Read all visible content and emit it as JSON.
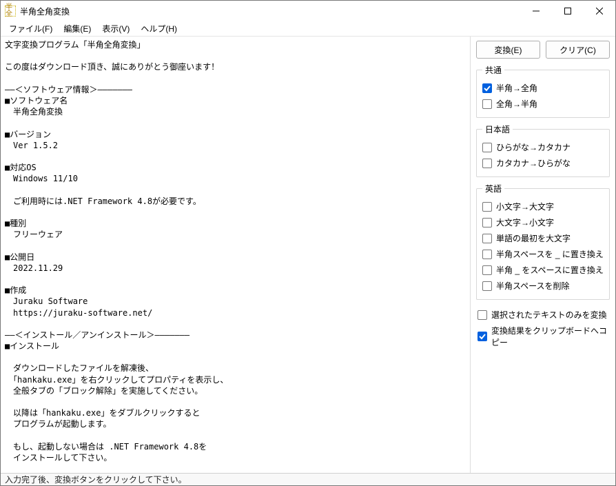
{
  "window": {
    "title": "半角全角変換",
    "icon_label": "半全"
  },
  "menubar": {
    "file": "ファイル(F)",
    "edit": "編集(E)",
    "view": "表示(V)",
    "help": "ヘルプ(H)"
  },
  "editor": "文字変換プログラム「半角全角変換」\n\nこの度はダウンロード頂き、誠にありがとう御座います！\n\n――＜ソフトウェア情報＞―――――――\n■ソフトウェア名\n　半角全角変換\n\n■バージョン\n　Ver 1.5.2\n\n■対応OS\n　Windows 11/10\n\n　ご利用時には.NET Framework 4.8が必要です。\n\n■種別\n　フリーウェア\n\n■公開日\n　2022.11.29\n\n■作成\n　Juraku Software\n　https://juraku-software.net/\n\n――＜インストール／アンインストール＞―――――――\n■インストール\n\n　ダウンロードしたファイルを解凍後、\n　「hankaku.exe」を右クリックしてプロパティを表示し、\n　全般タブの「ブロック解除」を実施してください。\n\n　以降は「hankaku.exe」をダブルクリックすると\n　プログラムが起動します。\n\n　もし、起動しない場合は .NET Framework 4.8を\n　インストールして下さい。\n\n\n■アンインストール\n\n　ダウンロードしたファイルを直接削除するだけで\n　アンインストールは完了です。\n　尚、レジストリは利用しておりません。\n\n\n――＜利用方法＞―――――――\n\n1.変換したい文字を入力又は貼り付けて下さい。\n　ファイル→ファイル読込からファイル内容を読み込む",
  "buttons": {
    "convert": "変換(E)",
    "clear": "クリア(C)"
  },
  "groups": {
    "common": {
      "legend": "共通",
      "items": {
        "han_to_zen": {
          "label": "半角→全角",
          "checked": true
        },
        "zen_to_han": {
          "label": "全角→半角",
          "checked": false
        }
      }
    },
    "japanese": {
      "legend": "日本語",
      "items": {
        "hira_to_kata": {
          "label": "ひらがな→カタカナ",
          "checked": false
        },
        "kata_to_hira": {
          "label": "カタカナ→ひらがな",
          "checked": false
        }
      }
    },
    "english": {
      "legend": "英語",
      "items": {
        "lower_to_upper": {
          "label": "小文字→大文字",
          "checked": false
        },
        "upper_to_lower": {
          "label": "大文字→小文字",
          "checked": false
        },
        "initial_upper": {
          "label": "単語の最初を大文字",
          "checked": false
        },
        "space_to_underscore": {
          "label": "半角スペースを _ に置き換え",
          "checked": false
        },
        "underscore_to_space": {
          "label": "半角 _ をスペースに置き換え",
          "checked": false
        },
        "remove_space": {
          "label": "半角スペースを削除",
          "checked": false
        }
      }
    }
  },
  "extra": {
    "selected_only": {
      "label": "選択されたテキストのみを変換",
      "checked": false
    },
    "copy_clipboard": {
      "label": "変換結果をクリップボードへコピー",
      "checked": true
    }
  },
  "statusbar": "入力完了後、変換ボタンをクリックして下さい。"
}
